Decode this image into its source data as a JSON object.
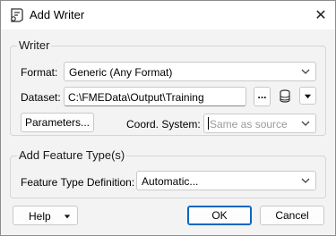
{
  "window": {
    "title": "Add Writer",
    "close_glyph": "✕"
  },
  "writer_group": {
    "label": "Writer",
    "format_label": "Format:",
    "format_value": "Generic (Any Format)",
    "dataset_label": "Dataset:",
    "dataset_value": "C:\\FMEData\\Output\\Training",
    "browse_label": "...",
    "parameters_label": "Parameters...",
    "coord_label": "Coord. System:",
    "coord_placeholder": "Same as source"
  },
  "feature_group": {
    "label": "Add Feature Type(s)",
    "ftd_label": "Feature Type Definition:",
    "ftd_value": "Automatic..."
  },
  "footer": {
    "help_label": "Help",
    "ok_label": "OK",
    "cancel_label": "Cancel"
  },
  "icons": [
    "app-writer-icon",
    "close-icon",
    "chevron-down-icon",
    "database-icon",
    "dropdown-arrow-icon"
  ],
  "colors": {
    "accent": "#0067c0",
    "background": "#f3f3f3",
    "titlebar": "#ffffff"
  }
}
